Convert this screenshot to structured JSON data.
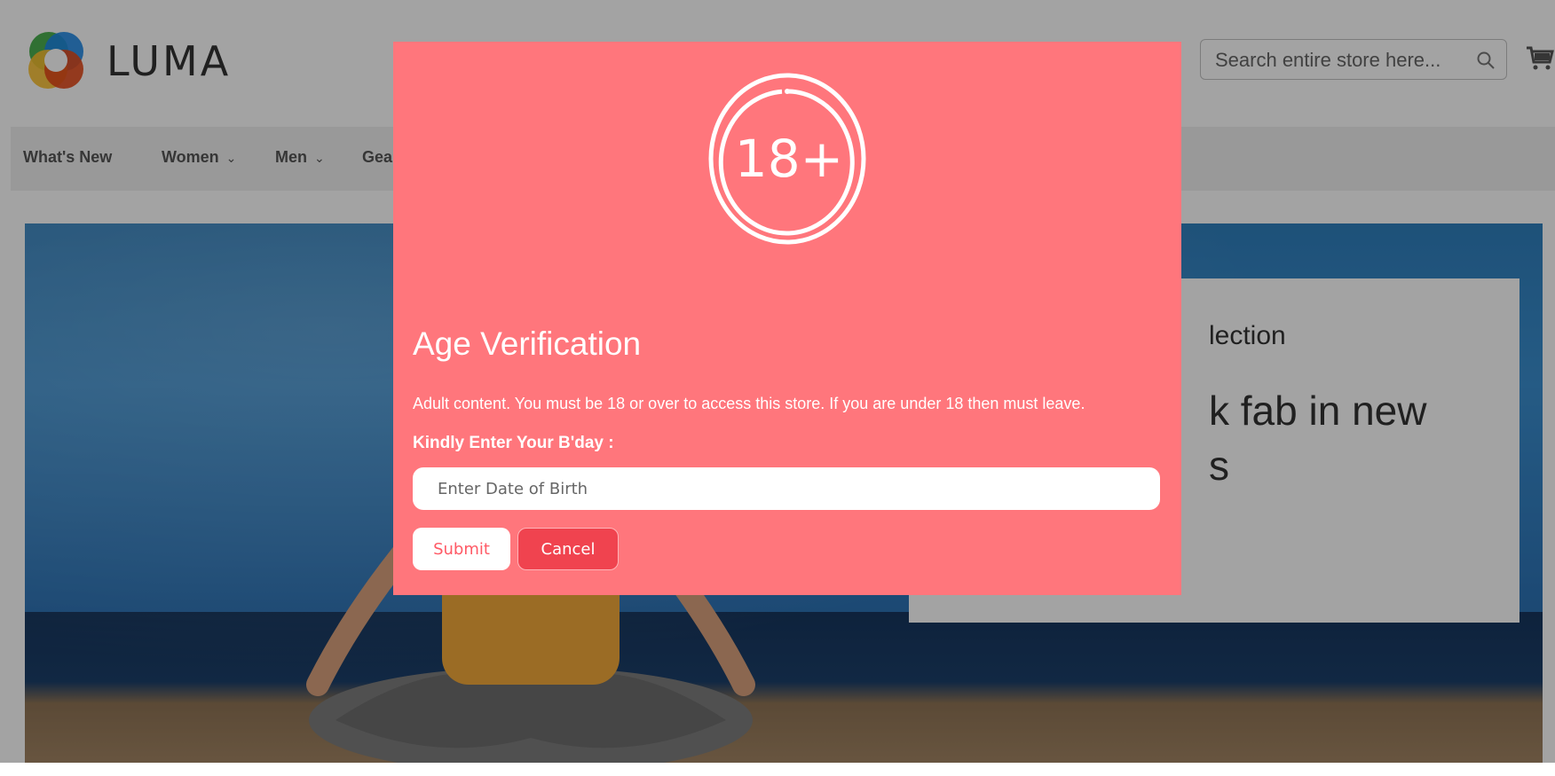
{
  "header": {
    "logo_text": "LUMA",
    "search": {
      "placeholder": "Search entire store here..."
    }
  },
  "nav": {
    "items": [
      {
        "label": "What's New",
        "has_dropdown": false
      },
      {
        "label": "Women",
        "has_dropdown": true
      },
      {
        "label": "Men",
        "has_dropdown": true
      },
      {
        "label": "Gea",
        "has_dropdown": false
      }
    ]
  },
  "hero": {
    "promo_subtitle_fragment": "lection",
    "promo_heading_line1_fragment": "k fab in new",
    "promo_heading_line2_fragment": "s"
  },
  "modal": {
    "badge_text": "18+",
    "title": "Age Verification",
    "message": "Adult content. You must be 18 or over to access this store. If you are under 18 then must leave.",
    "dob_label": "Kindly Enter Your B'day :",
    "dob_placeholder": "Enter Date of Birth",
    "submit_label": "Submit",
    "cancel_label": "Cancel"
  },
  "colors": {
    "modal_background": "#ff767c",
    "cancel_button": "#f0434f",
    "submit_text": "#ff5a66"
  },
  "icons": [
    "luma-logo-icon",
    "search-icon",
    "cart-icon",
    "chevron-down-icon",
    "age-18-plus-icon"
  ]
}
